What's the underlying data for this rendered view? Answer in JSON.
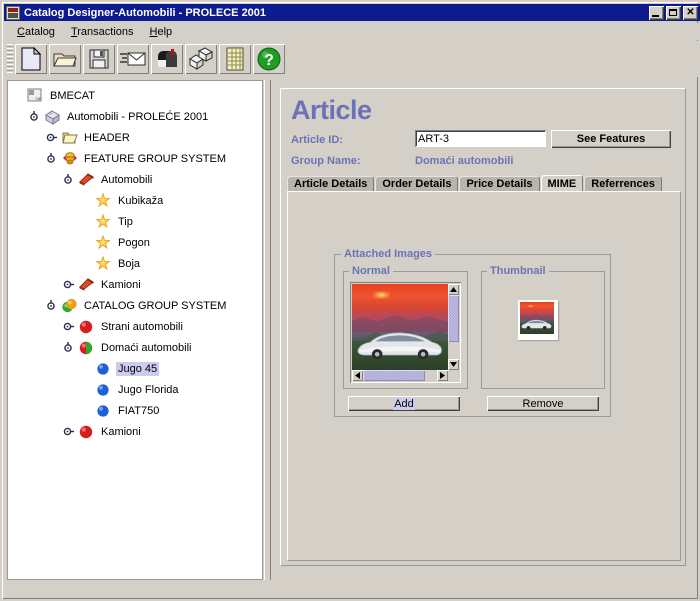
{
  "window": {
    "title": "Catalog Designer-Automobili - PROLECE 2001",
    "icon": "app-icon",
    "buttons": {
      "minimize": "_",
      "maximize": "□",
      "close": "✕"
    },
    "titlebar_color": "#0c1c8f",
    "face_color": "#d4d0c8"
  },
  "menubar": {
    "items": [
      {
        "label": "Catalog",
        "mnemonic": "C"
      },
      {
        "label": "Transactions",
        "mnemonic": "T"
      },
      {
        "label": "Help",
        "mnemonic": "H"
      }
    ]
  },
  "toolbar": {
    "buttons": [
      {
        "name": "new-document-button",
        "icon": "new-document-icon",
        "tooltip": "New"
      },
      {
        "name": "open-folder-button",
        "icon": "open-folder-icon",
        "tooltip": "Open"
      },
      {
        "name": "save-button",
        "icon": "floppy-disk-icon",
        "tooltip": "Save"
      },
      {
        "name": "send-mail-button",
        "icon": "mail-send-icon",
        "tooltip": "Send"
      },
      {
        "name": "mailbox-button",
        "icon": "mailbox-icon",
        "tooltip": "Mailbox"
      },
      {
        "name": "import-export-button",
        "icon": "boxes-icon",
        "tooltip": "Import/Export"
      },
      {
        "name": "report-button",
        "icon": "spreadsheet-icon",
        "tooltip": "Report"
      },
      {
        "name": "help-button",
        "icon": "question-mark-icon",
        "tooltip": "Help"
      }
    ]
  },
  "tree": {
    "nodes": [
      {
        "label": "BMECAT",
        "indent": 0,
        "handle": "none",
        "icon": "bmecat-icon",
        "selected": false
      },
      {
        "label": "Automobili - PROLEĆE 2001",
        "indent": 1,
        "handle": "expanded",
        "icon": "catalog-icon",
        "selected": false
      },
      {
        "label": "HEADER",
        "indent": 2,
        "handle": "collapsed",
        "icon": "header-folder-icon",
        "selected": false
      },
      {
        "label": "FEATURE GROUP SYSTEM",
        "indent": 2,
        "handle": "expanded",
        "icon": "feature-system-icon",
        "selected": false
      },
      {
        "label": "Automobili",
        "indent": 3,
        "handle": "expanded",
        "icon": "feature-group-icon",
        "selected": false
      },
      {
        "label": "Kubikaža",
        "indent": 4,
        "handle": "none",
        "icon": "star-icon",
        "selected": false
      },
      {
        "label": "Tip",
        "indent": 4,
        "handle": "none",
        "icon": "star-icon",
        "selected": false
      },
      {
        "label": "Pogon",
        "indent": 4,
        "handle": "none",
        "icon": "star-icon",
        "selected": false
      },
      {
        "label": "Boja",
        "indent": 4,
        "handle": "none",
        "icon": "star-icon",
        "selected": false
      },
      {
        "label": "Kamioni",
        "indent": 3,
        "handle": "collapsed",
        "icon": "feature-group-icon",
        "selected": false
      },
      {
        "label": "CATALOG GROUP SYSTEM",
        "indent": 2,
        "handle": "expanded",
        "icon": "group-system-icon",
        "selected": false
      },
      {
        "label": "Strani automobili",
        "indent": 3,
        "handle": "collapsed",
        "icon": "red-sphere-icon",
        "selected": false
      },
      {
        "label": "Domaći automobili",
        "indent": 3,
        "handle": "expanded",
        "icon": "mixed-sphere-icon",
        "selected": false
      },
      {
        "label": "Jugo 45",
        "indent": 4,
        "handle": "none",
        "icon": "blue-sphere-icon",
        "selected": true
      },
      {
        "label": "Jugo Florida",
        "indent": 4,
        "handle": "none",
        "icon": "blue-sphere-icon",
        "selected": false
      },
      {
        "label": "FIAT750",
        "indent": 4,
        "handle": "none",
        "icon": "blue-sphere-icon",
        "selected": false
      },
      {
        "label": "Kamioni",
        "indent": 3,
        "handle": "collapsed",
        "icon": "red-sphere-icon",
        "selected": false
      }
    ]
  },
  "article": {
    "heading": "Article",
    "heading_color": "#6b72b8",
    "article_id_label": "Article ID:",
    "article_id_value": "ART-3",
    "article_id_placeholder": "",
    "see_features_label": "See Features",
    "group_name_label": "Group Name:",
    "group_name_value": "Domaći automobili"
  },
  "tabs": [
    {
      "label": "Article Details",
      "active": false
    },
    {
      "label": "Order Details",
      "active": false
    },
    {
      "label": "Price Details",
      "active": false
    },
    {
      "label": "MIME",
      "active": true
    },
    {
      "label": "Referrences",
      "active": false
    }
  ],
  "mime_panel": {
    "attached_images_legend": "Attached Images",
    "normal_legend": "Normal",
    "thumbnail_legend": "Thumbnail",
    "add_label": "Add",
    "remove_label": "Remove",
    "normal_image_alt": "silver sports car at sunset",
    "thumbnail_image_alt": "silver sports car at sunset thumbnail"
  }
}
